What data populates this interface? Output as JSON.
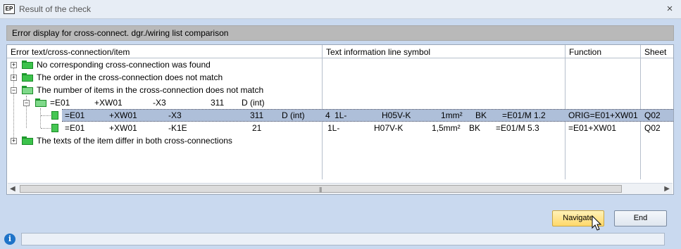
{
  "window": {
    "title": "Result of the check",
    "app_icon_text": "EP",
    "close_glyph": "×"
  },
  "panel": {
    "heading": "Error display for cross-connect. dgr./wiring list comparison"
  },
  "columns": [
    "Error text/cross-connection/item",
    "Text information line symbol",
    "Function",
    "Sheet"
  ],
  "tree": {
    "group1": "No corresponding cross-connection was found",
    "group2": "The order in the cross-connection does not match",
    "group3": "The number of items in the cross-connection does not match",
    "group4": "The texts of the item differ in both cross-connections",
    "sub": {
      "a": "=E01",
      "b": "+XW01",
      "c": "-X3",
      "d": "311",
      "e": "D (int)"
    },
    "item1": {
      "a": "=E01",
      "b": "+XW01",
      "c": "-X3",
      "d": "311",
      "e": "D (int)",
      "line": "4",
      "ls1": "1L-",
      "ls2": "H05V-K",
      "ls3": "1mm²",
      "ls4": "BK",
      "ls5": "=E01/M 1.2",
      "function": "ORIG=E01+XW01",
      "sheet": "Q02"
    },
    "item2": {
      "a": "=E01",
      "b": "+XW01",
      "c": "-K1E",
      "d": "21",
      "ls1": "1L-",
      "ls2": "H07V-K",
      "ls3": "1,5mm²",
      "ls4": "BK",
      "ls5": "=E01/M 5.3",
      "function": "=E01+XW01",
      "sheet": "Q02"
    }
  },
  "buttons": {
    "navigate": "Navigate",
    "end": "End"
  },
  "status": {
    "info_glyph": "i",
    "text": ""
  },
  "icons": {
    "expand": "+",
    "collapse": "−",
    "scroll_left": "◀",
    "scroll_right": "▶",
    "grip": "|||"
  }
}
